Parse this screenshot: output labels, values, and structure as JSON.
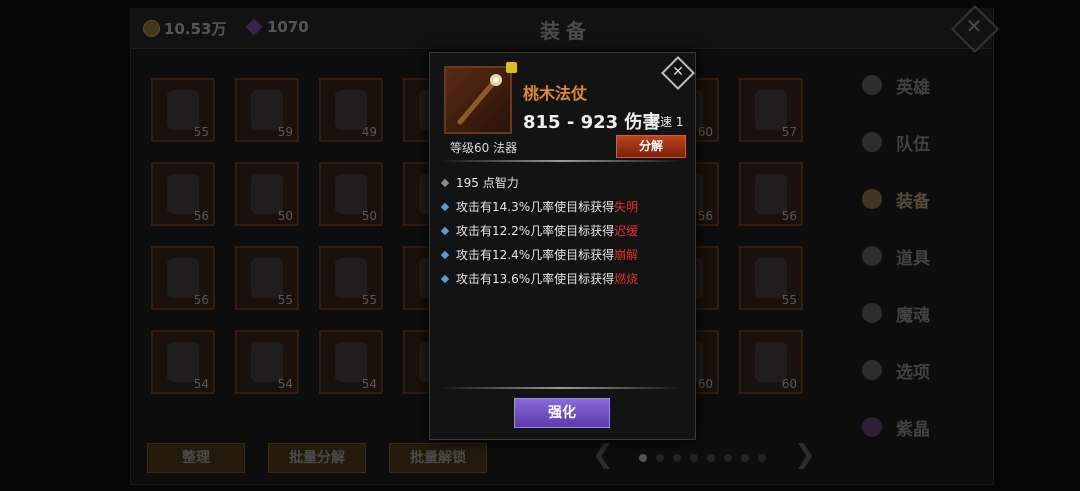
{
  "header": {
    "gold": "10.53万",
    "gems": "1070",
    "title": "装备"
  },
  "inventory": {
    "levels": [
      "55",
      "59",
      "49",
      "",
      "60",
      "57",
      "56",
      "50",
      "50",
      "",
      "56",
      "56",
      "56",
      "55",
      "55",
      "",
      "",
      "55",
      "54",
      "54",
      "54",
      "",
      "60",
      "60"
    ]
  },
  "sidebar": {
    "items": [
      {
        "label": "英雄",
        "icon": "hero-icon"
      },
      {
        "label": "队伍",
        "icon": "flag-icon"
      },
      {
        "label": "装备",
        "icon": "helmet-icon"
      },
      {
        "label": "道具",
        "icon": "bag-icon"
      },
      {
        "label": "魔魂",
        "icon": "flame-icon"
      },
      {
        "label": "选项",
        "icon": "gear-icon"
      },
      {
        "label": "紫晶",
        "icon": "crystal-icon"
      }
    ]
  },
  "bottom": {
    "sort_label": "整理",
    "batch_decompose_label": "批量分解",
    "batch_unlock_label": "批量解锁"
  },
  "popup": {
    "name": "桃木法仗",
    "damage": "815 - 923 伤害",
    "speed": "攻速 1",
    "level_type": "等级60 法器",
    "decompose_label": "分解",
    "base_stat": "195 点智力",
    "effects": [
      {
        "text": "攻击有14.3%几率使目标获得",
        "keyword": "失明"
      },
      {
        "text": "攻击有12.2%几率使目标获得",
        "keyword": "迟缓"
      },
      {
        "text": "攻击有12.4%几率使目标获得",
        "keyword": "崩解"
      },
      {
        "text": "攻击有13.6%几率使目标获得",
        "keyword": "燃烧"
      }
    ],
    "enhance_label": "强化"
  },
  "colors": {
    "name": "#e08a2a",
    "keyword": "#e03030",
    "enhance": "#6a4ac0"
  }
}
